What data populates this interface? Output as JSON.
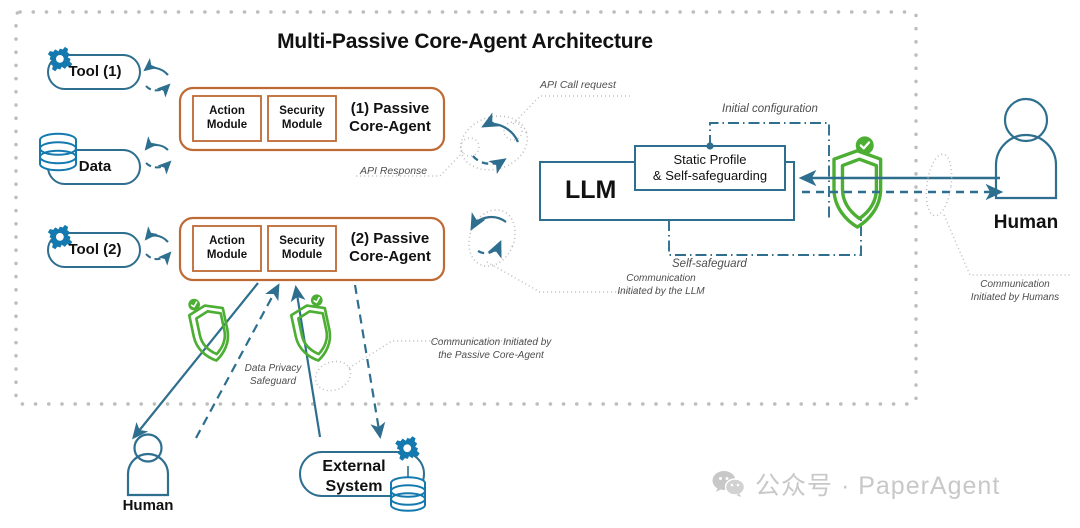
{
  "diagram": {
    "title": "Multi-Passive Core-Agent Architecture",
    "colors": {
      "teal": "#2E6E8E",
      "blue_icon": "#1379AE",
      "orange": "#BE6A34",
      "green": "#4CAF33",
      "dotted_gray": "#BDBDBD",
      "text": "#111111",
      "anno_text": "#4E4E4E",
      "watermark": "#C8C8C8"
    },
    "boundary": {
      "name": "system-boundary",
      "style": "dotted"
    }
  },
  "resources": [
    {
      "id": "tool1",
      "label": "Tool (1)",
      "icon": "gear-icon"
    },
    {
      "id": "data",
      "label": "Data",
      "icon": "database-icon"
    },
    {
      "id": "tool2",
      "label": "Tool (2)",
      "icon": "gear-icon"
    }
  ],
  "agents": [
    {
      "id": "agent1",
      "title_line1": "(1) Passive",
      "title_line2": "Core-Agent",
      "modules": [
        {
          "line1": "Action",
          "line2": "Module"
        },
        {
          "line1": "Security",
          "line2": "Module"
        }
      ]
    },
    {
      "id": "agent2",
      "title_line1": "(2) Passive",
      "title_line2": "Core-Agent",
      "modules": [
        {
          "line1": "Action",
          "line2": "Module"
        },
        {
          "line1": "Security",
          "line2": "Module"
        }
      ]
    }
  ],
  "llm": {
    "label": "LLM",
    "profile_line1": "Static Profile",
    "profile_line2": "& Self-safeguarding"
  },
  "actors": {
    "human_right": {
      "label": "Human",
      "icon": "person-icon"
    },
    "human_bottom": {
      "label": "Human",
      "icon": "person-icon"
    },
    "external_system": {
      "line1": "External",
      "line2": "System",
      "icons": [
        "gear-icon",
        "database-icon"
      ]
    }
  },
  "shields": [
    {
      "id": "llm-shield",
      "name": "self-safeguard-shield",
      "icon": "shield-check-icon"
    },
    {
      "id": "privacy-shield-1",
      "name": "data-privacy-shield",
      "icon": "shield-check-icon"
    },
    {
      "id": "privacy-shield-2",
      "name": "data-privacy-shield",
      "icon": "shield-check-icon"
    }
  ],
  "annotations": {
    "api_call_request": "API Call request",
    "api_response": "API Response",
    "initial_configuration": "Initial configuration",
    "self_safeguard": "Self-safeguard",
    "comm_llm_l1": "Communication",
    "comm_llm_l2": "Initiated by the LLM",
    "comm_humans_l1": "Communication",
    "comm_humans_l2": "Initiated by Humans",
    "comm_agent_l1": "Communication Initiated by",
    "comm_agent_l2": "the Passive Core-Agent",
    "privacy_l1": "Data Privacy",
    "privacy_l2": "Safeguard"
  },
  "watermark": {
    "icon": "wechat-icon",
    "text": "公众号 · PaperAgent"
  }
}
